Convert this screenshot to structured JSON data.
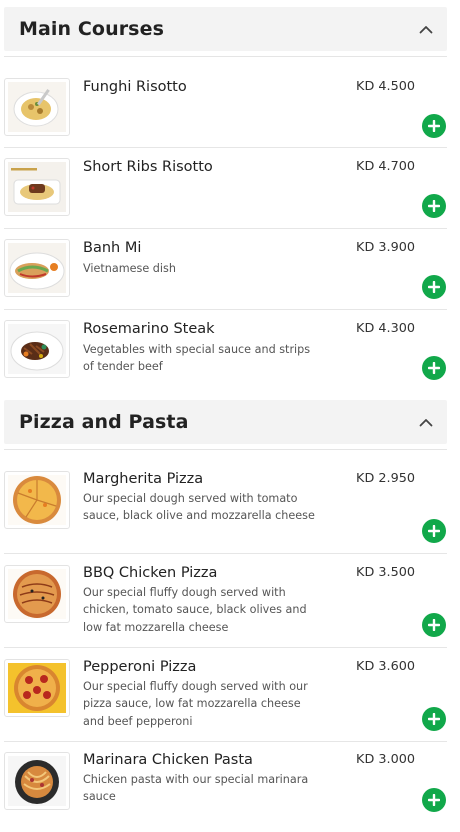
{
  "sections": [
    {
      "title": "Main Courses",
      "items": [
        {
          "name": "Funghi Risotto",
          "description": "",
          "price": "KD 4.500",
          "icon": "risotto-dish-icon"
        },
        {
          "name": "Short Ribs Risotto",
          "description": "",
          "price": "KD 4.700",
          "icon": "short-ribs-dish-icon"
        },
        {
          "name": "Banh Mi",
          "description": "Vietnamese dish",
          "price": "KD 3.900",
          "icon": "banh-mi-dish-icon"
        },
        {
          "name": "Rosemarino Steak",
          "description": "Vegetables with special sauce and strips of tender beef",
          "price": "KD 4.300",
          "icon": "steak-dish-icon"
        }
      ]
    },
    {
      "title": "Pizza and Pasta",
      "items": [
        {
          "name": "Margherita Pizza",
          "description": "Our special dough served with tomato sauce, black olive and mozzarella cheese",
          "price": "KD 2.950",
          "icon": "margherita-pizza-icon"
        },
        {
          "name": "BBQ Chicken Pizza",
          "description": "Our special fluffy dough served with chicken, tomato sauce, black olives and low fat mozzarella cheese",
          "price": "KD 3.500",
          "icon": "bbq-pizza-icon"
        },
        {
          "name": "Pepperoni Pizza",
          "description": "Our special fluffy dough served with our pizza sauce, low fat mozzarella cheese and beef pepperoni",
          "price": "KD 3.600",
          "icon": "pepperoni-pizza-icon"
        },
        {
          "name": "Marinara Chicken Pasta",
          "description": "Chicken pasta with our special marinara sauce",
          "price": "KD 3.000",
          "icon": "pasta-dish-icon"
        }
      ]
    }
  ],
  "colors": {
    "add_button": "#11a84a",
    "header_bg": "#f3f3f3",
    "accent_text": "#222222"
  }
}
